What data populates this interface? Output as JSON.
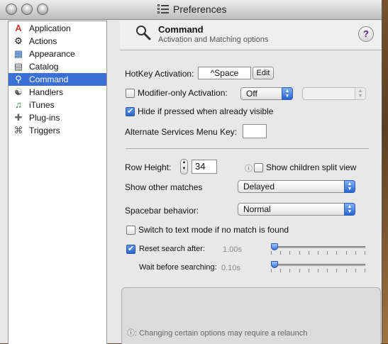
{
  "window": {
    "title": "Preferences"
  },
  "sidebar": {
    "items": [
      {
        "label": "Application",
        "icon": "application-icon"
      },
      {
        "label": "Actions",
        "icon": "gear-icon"
      },
      {
        "label": "Appearance",
        "icon": "appearance-icon"
      },
      {
        "label": "Catalog",
        "icon": "catalog-icon"
      },
      {
        "label": "Command",
        "icon": "magnifier-icon",
        "selected": true
      },
      {
        "label": "Handlers",
        "icon": "handlers-icon"
      },
      {
        "label": "iTunes",
        "icon": "itunes-icon"
      },
      {
        "label": "Plug-ins",
        "icon": "plugin-icon"
      },
      {
        "label": "Triggers",
        "icon": "triggers-icon"
      }
    ]
  },
  "header": {
    "title": "Command",
    "subtitle": "Activation and Matching options",
    "help_label": "?"
  },
  "hotkey": {
    "label": "HotKey Activation:",
    "value": "^Space",
    "edit_label": "Edit"
  },
  "modifier": {
    "label": "Modifier-only Activation:",
    "checked": false,
    "value": "Off",
    "second_value": ""
  },
  "hide_if_visible": {
    "label": "Hide if pressed when already visible",
    "checked": true
  },
  "services_key": {
    "label": "Alternate Services Menu Key:",
    "value": ""
  },
  "row_height": {
    "label": "Row Height:",
    "value": "34"
  },
  "children_split": {
    "info_icon": "ⓘ",
    "label": "Show children split view",
    "checked": false
  },
  "other_matches": {
    "label": "Show other matches",
    "value": "Delayed"
  },
  "spacebar": {
    "label": "Spacebar behavior:",
    "value": "Normal"
  },
  "text_mode": {
    "label": "Switch to text mode if no match is found",
    "checked": false
  },
  "reset_search": {
    "label": "Reset search after:",
    "checked": true,
    "value_text": "1.00s",
    "level": 0.0
  },
  "wait_search": {
    "label": "Wait before searching:",
    "value_text": "0.10s",
    "level": 0.0
  },
  "footer": {
    "note": "ⓘ: Changing certain options may require a relaunch"
  },
  "colors": {
    "selection": "#3a6fd4",
    "checkbox_on": "#2d65c8"
  }
}
